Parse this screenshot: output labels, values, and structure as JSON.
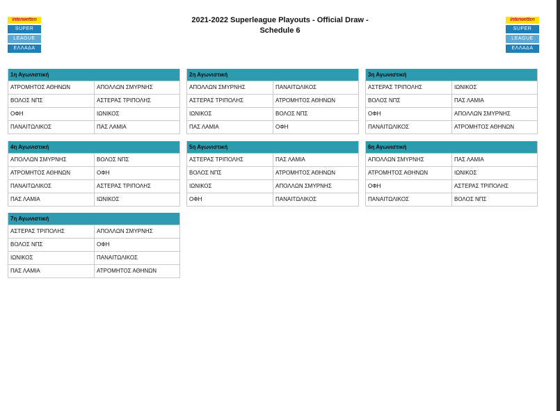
{
  "header": {
    "title_line1": "2021-2022 Superleague Playouts - Official Draw -",
    "title_line2": "Schedule  6"
  },
  "logo": {
    "brand": "interwetten",
    "line1": "SUPER",
    "line2": "LEAGUE",
    "line3": "ΕΛΛΑΔΑ"
  },
  "colors": {
    "header_band": "#2e9bb0",
    "border": "#c9c9c9",
    "logo_blue": "#1f7fb8",
    "logo_yellow": "#ffe300"
  },
  "rounds": [
    {
      "label": "1η Αγωνιστική",
      "matches": [
        {
          "home": "ΑΤΡΟΜΗΤΟΣ ΑΘΗΝΩΝ",
          "away": "ΑΠΟΛΛΩΝ ΣΜΥΡΝΗΣ"
        },
        {
          "home": "ΒΟΛΟΣ ΝΠΣ",
          "away": "ΑΣΤΕΡΑΣ ΤΡΙΠΟΛΗΣ"
        },
        {
          "home": "ΟΦΗ",
          "away": "ΙΩΝΙΚΟΣ"
        },
        {
          "home": "ΠΑΝΑΙΤΩΛΙΚΟΣ",
          "away": "ΠΑΣ ΛΑΜΙΑ"
        }
      ]
    },
    {
      "label": "2η Αγωνιστική",
      "matches": [
        {
          "home": "ΑΠΟΛΛΩΝ ΣΜΥΡΝΗΣ",
          "away": "ΠΑΝΑΙΤΩΛΙΚΟΣ"
        },
        {
          "home": "ΑΣΤΕΡΑΣ ΤΡΙΠΟΛΗΣ",
          "away": "ΑΤΡΟΜΗΤΟΣ ΑΘΗΝΩΝ"
        },
        {
          "home": "ΙΩΝΙΚΟΣ",
          "away": "ΒΟΛΟΣ ΝΠΣ"
        },
        {
          "home": "ΠΑΣ ΛΑΜΙΑ",
          "away": "ΟΦΗ"
        }
      ]
    },
    {
      "label": "3η Αγωνιστική",
      "matches": [
        {
          "home": "ΑΣΤΕΡΑΣ ΤΡΙΠΟΛΗΣ",
          "away": "ΙΩΝΙΚΟΣ"
        },
        {
          "home": "ΒΟΛΟΣ ΝΠΣ",
          "away": "ΠΑΣ ΛΑΜΙΑ"
        },
        {
          "home": "ΟΦΗ",
          "away": "ΑΠΟΛΛΩΝ ΣΜΥΡΝΗΣ"
        },
        {
          "home": "ΠΑΝΑΙΤΩΛΙΚΟΣ",
          "away": "ΑΤΡΟΜΗΤΟΣ ΑΘΗΝΩΝ"
        }
      ]
    },
    {
      "label": "4η Αγωνιστική",
      "matches": [
        {
          "home": "ΑΠΟΛΛΩΝ ΣΜΥΡΝΗΣ",
          "away": "ΒΟΛΟΣ ΝΠΣ"
        },
        {
          "home": "ΑΤΡΟΜΗΤΟΣ ΑΘΗΝΩΝ",
          "away": "ΟΦΗ"
        },
        {
          "home": "ΠΑΝΑΙΤΩΛΙΚΟΣ",
          "away": "ΑΣΤΕΡΑΣ ΤΡΙΠΟΛΗΣ"
        },
        {
          "home": "ΠΑΣ ΛΑΜΙΑ",
          "away": "ΙΩΝΙΚΟΣ"
        }
      ]
    },
    {
      "label": "5η Αγωνιστική",
      "matches": [
        {
          "home": "ΑΣΤΕΡΑΣ ΤΡΙΠΟΛΗΣ",
          "away": "ΠΑΣ ΛΑΜΙΑ"
        },
        {
          "home": "ΒΟΛΟΣ ΝΠΣ",
          "away": "ΑΤΡΟΜΗΤΟΣ ΑΘΗΝΩΝ"
        },
        {
          "home": "ΙΩΝΙΚΟΣ",
          "away": "ΑΠΟΛΛΩΝ ΣΜΥΡΝΗΣ"
        },
        {
          "home": "ΟΦΗ",
          "away": "ΠΑΝΑΙΤΩΛΙΚΟΣ"
        }
      ]
    },
    {
      "label": "6η Αγωνιστική",
      "matches": [
        {
          "home": "ΑΠΟΛΛΩΝ ΣΜΥΡΝΗΣ",
          "away": "ΠΑΣ ΛΑΜΙΑ"
        },
        {
          "home": "ΑΤΡΟΜΗΤΟΣ ΑΘΗΝΩΝ",
          "away": "ΙΩΝΙΚΟΣ"
        },
        {
          "home": "ΟΦΗ",
          "away": "ΑΣΤΕΡΑΣ ΤΡΙΠΟΛΗΣ"
        },
        {
          "home": "ΠΑΝΑΙΤΩΛΙΚΟΣ",
          "away": "ΒΟΛΟΣ ΝΠΣ"
        }
      ]
    },
    {
      "label": "7η Αγωνιστική",
      "matches": [
        {
          "home": "ΑΣΤΕΡΑΣ ΤΡΙΠΟΛΗΣ",
          "away": "ΑΠΟΛΛΩΝ ΣΜΥΡΝΗΣ"
        },
        {
          "home": "ΒΟΛΟΣ ΝΠΣ",
          "away": "ΟΦΗ"
        },
        {
          "home": "ΙΩΝΙΚΟΣ",
          "away": "ΠΑΝΑΙΤΩΛΙΚΟΣ"
        },
        {
          "home": "ΠΑΣ ΛΑΜΙΑ",
          "away": "ΑΤΡΟΜΗΤΟΣ ΑΘΗΝΩΝ"
        }
      ]
    }
  ]
}
